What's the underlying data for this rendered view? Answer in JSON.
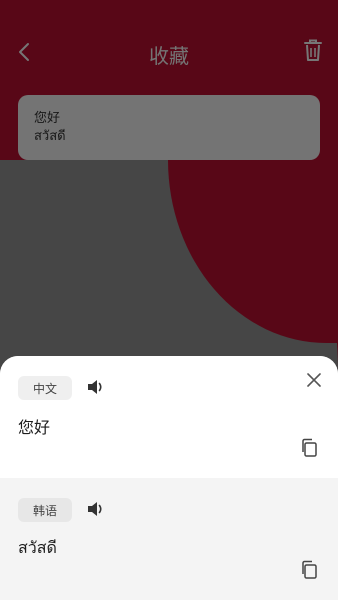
{
  "header": {
    "title": "收藏"
  },
  "favorites": [
    {
      "source": "您好",
      "target": "สวัสดี"
    }
  ],
  "sheet": {
    "source": {
      "lang_label": "中文",
      "text": "您好"
    },
    "target": {
      "lang_label": "韩语",
      "text": "สวัสดี"
    }
  },
  "icons": {
    "back": "chevron-left-icon",
    "trash": "trash-icon",
    "close": "close-icon",
    "speaker": "speaker-icon",
    "copy": "copy-icon"
  },
  "colors": {
    "brand_red": "#b10f2e",
    "grey_shape": "#8d8d8d",
    "overlay": "rgba(0,0,0,0.5)",
    "sheet_bottom": "#f4f4f4"
  }
}
